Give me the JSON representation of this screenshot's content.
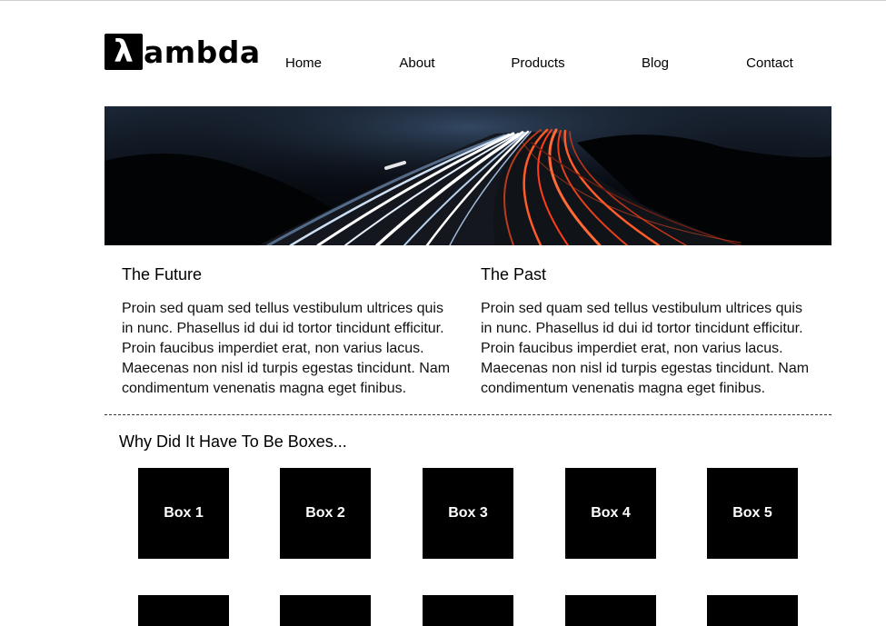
{
  "header": {
    "logo_symbol": "λ",
    "logo_text": "ambda",
    "nav": [
      {
        "label": "Home"
      },
      {
        "label": "About"
      },
      {
        "label": "Products"
      },
      {
        "label": "Blog"
      },
      {
        "label": "Contact"
      }
    ]
  },
  "hero": {
    "image": "highway-light-trails-icon"
  },
  "columns": [
    {
      "title": "The Future",
      "body": "Proin sed quam sed tellus vestibulum ultrices quis in nunc. Phasellus id dui id tortor tincidunt efficitur. Proin faucibus imperdiet erat, non varius lacus. Maecenas non nisl id turpis egestas tincidunt. Nam condimentum venenatis magna eget finibus."
    },
    {
      "title": "The Past",
      "body": "Proin sed quam sed tellus vestibulum ultrices quis in nunc. Phasellus id dui id tortor tincidunt efficitur. Proin faucibus imperdiet erat, non varius lacus. Maecenas non nisl id turpis egestas tincidunt. Nam condimentum venenatis magna eget finibus."
    }
  ],
  "boxes_section": {
    "title": "Why Did It Have To Be Boxes...",
    "boxes": [
      {
        "label": "Box 1"
      },
      {
        "label": "Box 2"
      },
      {
        "label": "Box 3"
      },
      {
        "label": "Box 4"
      },
      {
        "label": "Box 5"
      },
      {
        "label": ""
      },
      {
        "label": ""
      },
      {
        "label": ""
      },
      {
        "label": ""
      },
      {
        "label": ""
      }
    ]
  },
  "colors": {
    "background": "#ffffff",
    "box": "#000000",
    "text": "#111111"
  }
}
